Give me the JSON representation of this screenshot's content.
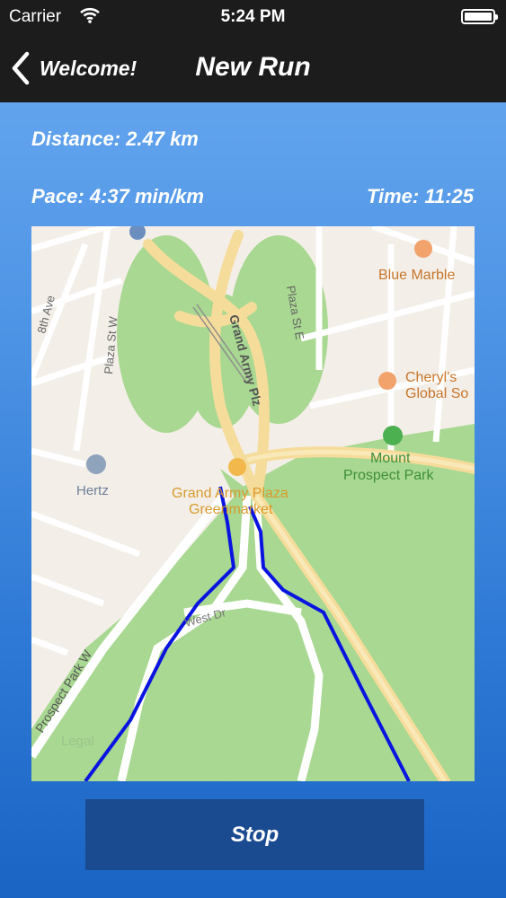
{
  "status_bar": {
    "carrier": "Carrier",
    "time": "5:24 PM"
  },
  "nav": {
    "back_label": "Welcome!",
    "title": "New Run"
  },
  "stats": {
    "distance": "Distance: 2.47 km",
    "pace": "Pace: 4:37 min/km",
    "time": "Time: 11:25"
  },
  "map": {
    "labels": {
      "blue_marble": "Blue Marble",
      "cheryls_1": "Cheryl's",
      "cheryls_2": "Global So",
      "mount_1": "Mount",
      "mount_2": "Prospect Park",
      "hertz": "Hertz",
      "gap_1": "Grand Army Plaza",
      "gap_2": "Greenmarket",
      "grand_army": "Grand Army Plz",
      "plaza_st_e": "Plaza St E",
      "plaza_st_w": "Plaza St W",
      "eighth_ave": "8th Ave",
      "west_dr": "West Dr",
      "prospect_park_w": "Prospect Park W",
      "legal": "Legal"
    },
    "route_color": "#0a14e0"
  },
  "actions": {
    "stop_label": "Stop"
  }
}
